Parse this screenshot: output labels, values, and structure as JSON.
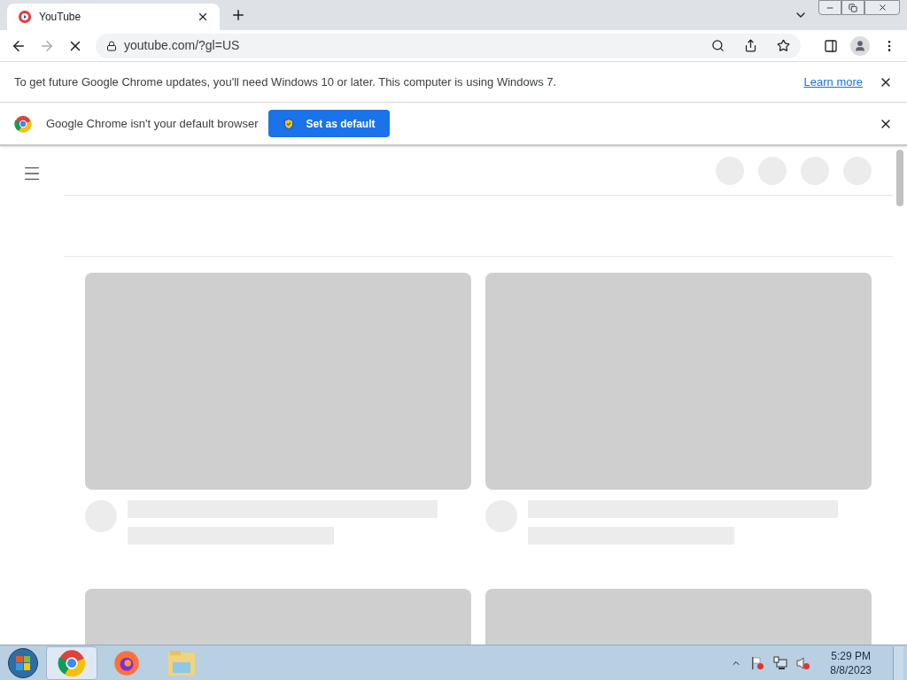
{
  "browser": {
    "tab": {
      "title": "YouTube",
      "selected": true
    },
    "address": "youtube.com/?gl=US",
    "loading": true
  },
  "infobars": [
    {
      "kind": "update",
      "message": "To get future Google Chrome updates, you'll need Windows 10 or later. This computer is using Windows 7.",
      "link": "Learn more"
    },
    {
      "kind": "default",
      "message": "Google Chrome isn't your default browser",
      "button": "Set as default"
    }
  ],
  "taskbar": {
    "apps": [
      {
        "kind": "chrome",
        "selected": true
      },
      {
        "kind": "firefox",
        "selected": false
      },
      {
        "kind": "explorer",
        "selected": false
      }
    ],
    "time": "5:29 PM",
    "date": "8/8/2023"
  }
}
